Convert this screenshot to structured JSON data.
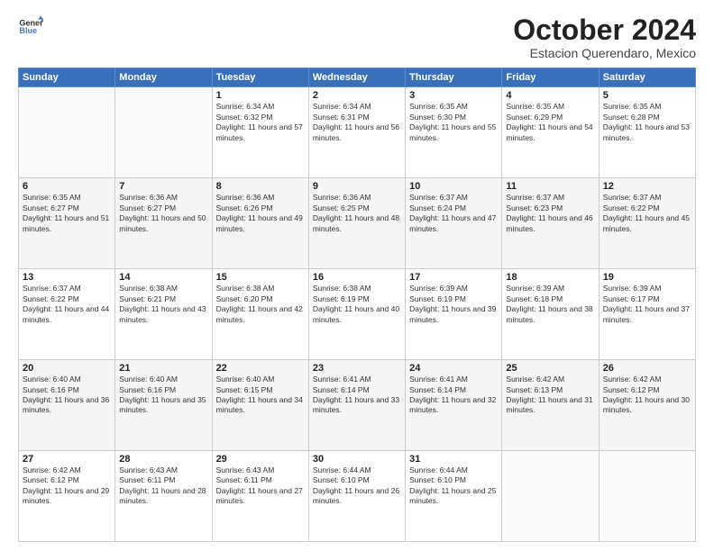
{
  "header": {
    "logo_line1": "General",
    "logo_line2": "Blue",
    "month_title": "October 2024",
    "location": "Estacion Querendaro, Mexico"
  },
  "weekdays": [
    "Sunday",
    "Monday",
    "Tuesday",
    "Wednesday",
    "Thursday",
    "Friday",
    "Saturday"
  ],
  "weeks": [
    [
      {
        "day": "",
        "info": ""
      },
      {
        "day": "",
        "info": ""
      },
      {
        "day": "1",
        "info": "Sunrise: 6:34 AM\nSunset: 6:32 PM\nDaylight: 11 hours and 57 minutes."
      },
      {
        "day": "2",
        "info": "Sunrise: 6:34 AM\nSunset: 6:31 PM\nDaylight: 11 hours and 56 minutes."
      },
      {
        "day": "3",
        "info": "Sunrise: 6:35 AM\nSunset: 6:30 PM\nDaylight: 11 hours and 55 minutes."
      },
      {
        "day": "4",
        "info": "Sunrise: 6:35 AM\nSunset: 6:29 PM\nDaylight: 11 hours and 54 minutes."
      },
      {
        "day": "5",
        "info": "Sunrise: 6:35 AM\nSunset: 6:28 PM\nDaylight: 11 hours and 53 minutes."
      }
    ],
    [
      {
        "day": "6",
        "info": "Sunrise: 6:35 AM\nSunset: 6:27 PM\nDaylight: 11 hours and 51 minutes."
      },
      {
        "day": "7",
        "info": "Sunrise: 6:36 AM\nSunset: 6:27 PM\nDaylight: 11 hours and 50 minutes."
      },
      {
        "day": "8",
        "info": "Sunrise: 6:36 AM\nSunset: 6:26 PM\nDaylight: 11 hours and 49 minutes."
      },
      {
        "day": "9",
        "info": "Sunrise: 6:36 AM\nSunset: 6:25 PM\nDaylight: 11 hours and 48 minutes."
      },
      {
        "day": "10",
        "info": "Sunrise: 6:37 AM\nSunset: 6:24 PM\nDaylight: 11 hours and 47 minutes."
      },
      {
        "day": "11",
        "info": "Sunrise: 6:37 AM\nSunset: 6:23 PM\nDaylight: 11 hours and 46 minutes."
      },
      {
        "day": "12",
        "info": "Sunrise: 6:37 AM\nSunset: 6:22 PM\nDaylight: 11 hours and 45 minutes."
      }
    ],
    [
      {
        "day": "13",
        "info": "Sunrise: 6:37 AM\nSunset: 6:22 PM\nDaylight: 11 hours and 44 minutes."
      },
      {
        "day": "14",
        "info": "Sunrise: 6:38 AM\nSunset: 6:21 PM\nDaylight: 11 hours and 43 minutes."
      },
      {
        "day": "15",
        "info": "Sunrise: 6:38 AM\nSunset: 6:20 PM\nDaylight: 11 hours and 42 minutes."
      },
      {
        "day": "16",
        "info": "Sunrise: 6:38 AM\nSunset: 6:19 PM\nDaylight: 11 hours and 40 minutes."
      },
      {
        "day": "17",
        "info": "Sunrise: 6:39 AM\nSunset: 6:19 PM\nDaylight: 11 hours and 39 minutes."
      },
      {
        "day": "18",
        "info": "Sunrise: 6:39 AM\nSunset: 6:18 PM\nDaylight: 11 hours and 38 minutes."
      },
      {
        "day": "19",
        "info": "Sunrise: 6:39 AM\nSunset: 6:17 PM\nDaylight: 11 hours and 37 minutes."
      }
    ],
    [
      {
        "day": "20",
        "info": "Sunrise: 6:40 AM\nSunset: 6:16 PM\nDaylight: 11 hours and 36 minutes."
      },
      {
        "day": "21",
        "info": "Sunrise: 6:40 AM\nSunset: 6:16 PM\nDaylight: 11 hours and 35 minutes."
      },
      {
        "day": "22",
        "info": "Sunrise: 6:40 AM\nSunset: 6:15 PM\nDaylight: 11 hours and 34 minutes."
      },
      {
        "day": "23",
        "info": "Sunrise: 6:41 AM\nSunset: 6:14 PM\nDaylight: 11 hours and 33 minutes."
      },
      {
        "day": "24",
        "info": "Sunrise: 6:41 AM\nSunset: 6:14 PM\nDaylight: 11 hours and 32 minutes."
      },
      {
        "day": "25",
        "info": "Sunrise: 6:42 AM\nSunset: 6:13 PM\nDaylight: 11 hours and 31 minutes."
      },
      {
        "day": "26",
        "info": "Sunrise: 6:42 AM\nSunset: 6:12 PM\nDaylight: 11 hours and 30 minutes."
      }
    ],
    [
      {
        "day": "27",
        "info": "Sunrise: 6:42 AM\nSunset: 6:12 PM\nDaylight: 11 hours and 29 minutes."
      },
      {
        "day": "28",
        "info": "Sunrise: 6:43 AM\nSunset: 6:11 PM\nDaylight: 11 hours and 28 minutes."
      },
      {
        "day": "29",
        "info": "Sunrise: 6:43 AM\nSunset: 6:11 PM\nDaylight: 11 hours and 27 minutes."
      },
      {
        "day": "30",
        "info": "Sunrise: 6:44 AM\nSunset: 6:10 PM\nDaylight: 11 hours and 26 minutes."
      },
      {
        "day": "31",
        "info": "Sunrise: 6:44 AM\nSunset: 6:10 PM\nDaylight: 11 hours and 25 minutes."
      },
      {
        "day": "",
        "info": ""
      },
      {
        "day": "",
        "info": ""
      }
    ]
  ]
}
